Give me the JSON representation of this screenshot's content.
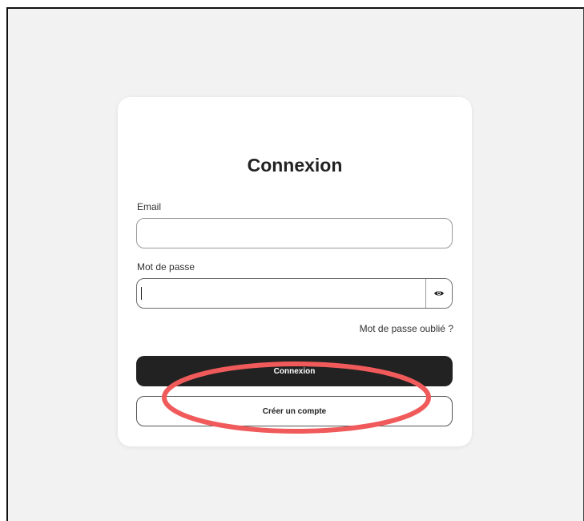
{
  "login": {
    "title": "Connexion",
    "email_label": "Email",
    "email_value": "",
    "password_label": "Mot de passe",
    "password_value": "",
    "toggle_icon": "eye-icon",
    "forgot_link": "Mot de passe oublié ?",
    "login_button": "Connexion",
    "create_button": "Créer un compte"
  },
  "colors": {
    "page_background": "#f2f2f2",
    "card_background": "#ffffff",
    "primary_button": "#222222",
    "annotation": "#f05a5a"
  }
}
